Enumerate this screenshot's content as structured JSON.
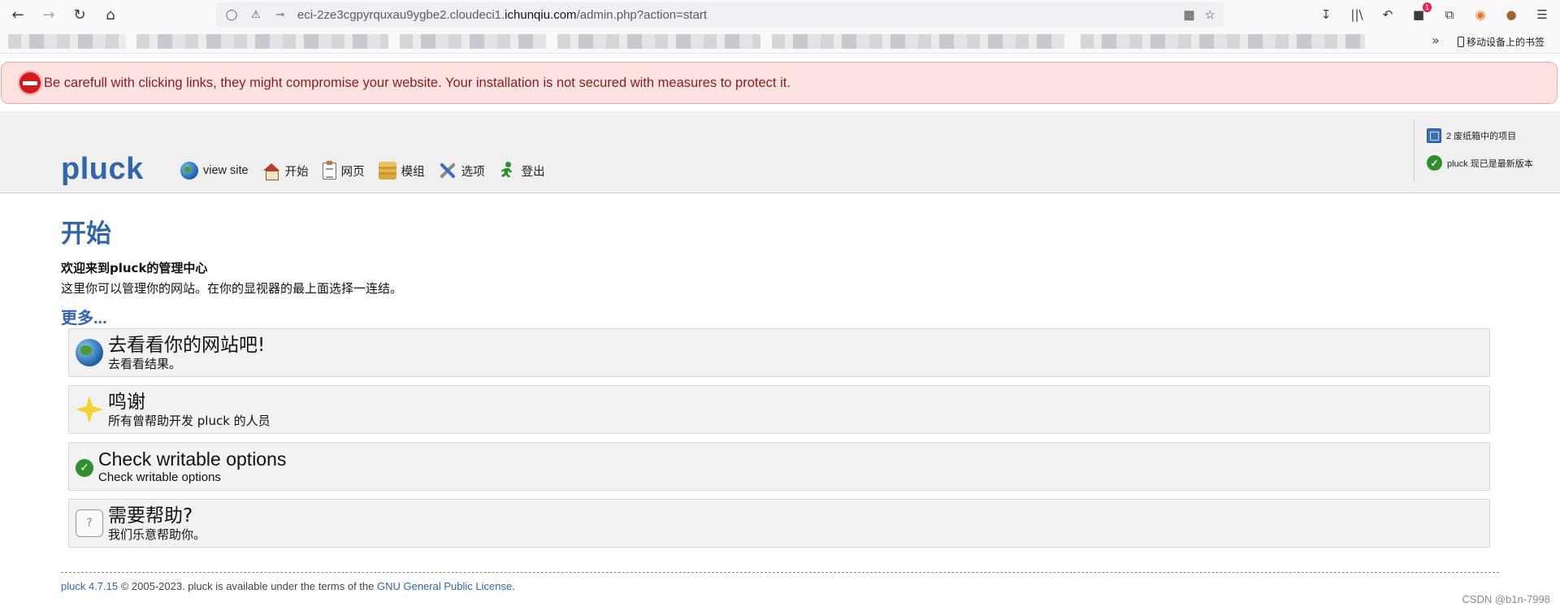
{
  "browser": {
    "url_prefix": "eci-2ze3cgpyrquxau9ygbe2.cloudeci1.",
    "url_host": "ichunqiu.com",
    "url_path": "/admin.php?action=start",
    "extension_badge": "1",
    "mobile_bookmarks_label": "移动设备上的书签"
  },
  "warning": {
    "text": "Be carefull with clicking links, they might compromise your website. Your installation is not secured with measures to protect it."
  },
  "header": {
    "logo": "pluck",
    "menu": [
      {
        "label": "view site"
      },
      {
        "label": "开始"
      },
      {
        "label": "网页"
      },
      {
        "label": "模组"
      },
      {
        "label": "选项"
      },
      {
        "label": "登出"
      }
    ],
    "trash_info": "2 废纸箱中的项目",
    "version_info": "pluck 现已是最新版本"
  },
  "content": {
    "title": "开始",
    "welcome": "欢迎来到pluck的管理中心",
    "intro": "这里你可以管理你的网站。在你的显视器的最上面选择一连结。",
    "more_heading": "更多..."
  },
  "boxes": [
    {
      "title": "去看看你的网站吧!",
      "desc": "去看看结果。"
    },
    {
      "title": "鸣谢",
      "desc": "所有曾帮助开发 pluck 的人员"
    },
    {
      "title": "Check writable options",
      "desc": "Check writable options"
    },
    {
      "title": "需要帮助?",
      "desc": "我们乐意帮助你。"
    }
  ],
  "footer": {
    "version": "pluck 4.7.15",
    "copyright": " © 2005-2023. pluck is available under the terms of the ",
    "license": "GNU General Public License",
    "period": "."
  },
  "watermark": "CSDN @b1n-7998",
  "colors": {
    "brand": "#3366a8",
    "warning_bg": "#fde2e2",
    "warning_text": "#8b1c1c"
  }
}
